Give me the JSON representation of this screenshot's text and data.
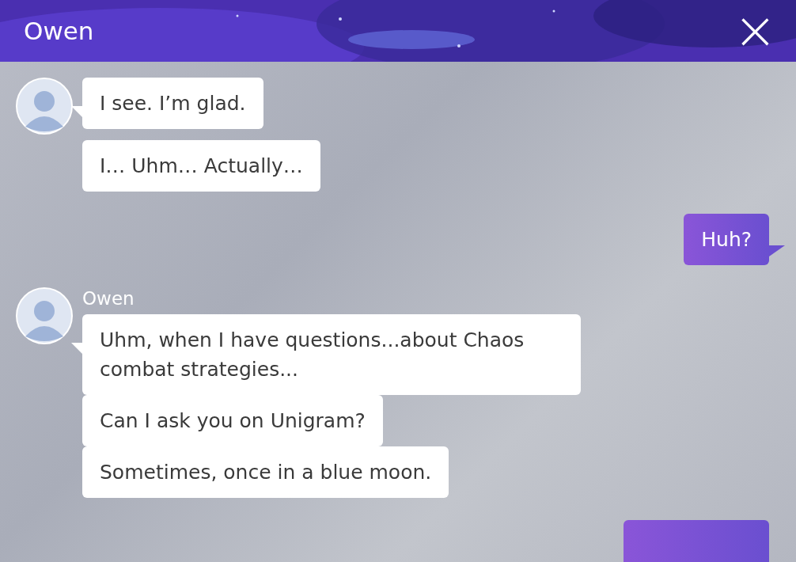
{
  "header": {
    "title": "Owen",
    "close": "×"
  },
  "groups": [
    {
      "kind": "incoming",
      "messages": [
        "I see. I’m glad.",
        "I… Uhm… Actually…"
      ]
    },
    {
      "kind": "outgoing",
      "messages": [
        "Huh?"
      ]
    },
    {
      "kind": "incoming",
      "sender": "Owen",
      "messages": [
        "Uhm, when I have questions...about Chaos combat strategies...",
        "Can I ask you on Unigram?",
        "Sometimes, once in a blue moon."
      ]
    },
    {
      "kind": "partial"
    }
  ]
}
